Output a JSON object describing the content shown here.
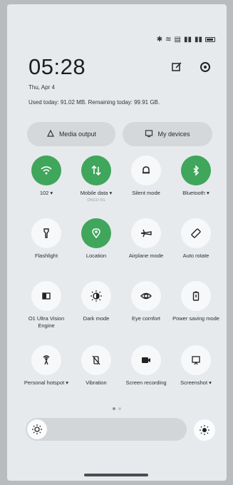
{
  "header": {
    "time": "05:28",
    "date": "Thu, Apr 4",
    "usage": "Used today: 91.02 MB. Remaining today: 99.91 GB."
  },
  "controls": {
    "media_output": "Media output",
    "my_devices": "My devices"
  },
  "tiles": [
    {
      "label": "102 ▾",
      "icon": "wifi-icon",
      "on": true
    },
    {
      "label": "Mobile data ▾",
      "sub": "ONCO 5G",
      "icon": "mobile-data-icon",
      "on": true
    },
    {
      "label": "Silent mode",
      "icon": "bell-icon",
      "on": false
    },
    {
      "label": "Bluetooth ▾",
      "icon": "bluetooth-icon",
      "on": true
    },
    {
      "label": "Flashlight",
      "icon": "flashlight-icon",
      "on": false
    },
    {
      "label": "Location",
      "icon": "location-icon",
      "on": true
    },
    {
      "label": "Airplane mode",
      "icon": "airplane-icon",
      "on": false
    },
    {
      "label": "Auto rotate",
      "icon": "rotate-icon",
      "on": false
    },
    {
      "label": "O1 Ultra Vision Engine",
      "icon": "vision-engine-icon",
      "on": false
    },
    {
      "label": "Dark mode",
      "icon": "dark-mode-icon",
      "on": false
    },
    {
      "label": "Eye comfort",
      "icon": "eye-icon",
      "on": false
    },
    {
      "label": "Power saving mode",
      "icon": "battery-icon",
      "on": false
    },
    {
      "label": "Personal hotspot ▾",
      "icon": "hotspot-icon",
      "on": false
    },
    {
      "label": "Vibration",
      "icon": "vibration-icon",
      "on": false
    },
    {
      "label": "Screen recording",
      "icon": "screen-record-icon",
      "on": false
    },
    {
      "label": "Screenshot ▾",
      "icon": "screenshot-icon",
      "on": false
    }
  ],
  "brightness": {
    "level": 0.0
  },
  "page_indicator": {
    "current": 1,
    "total": 2
  }
}
